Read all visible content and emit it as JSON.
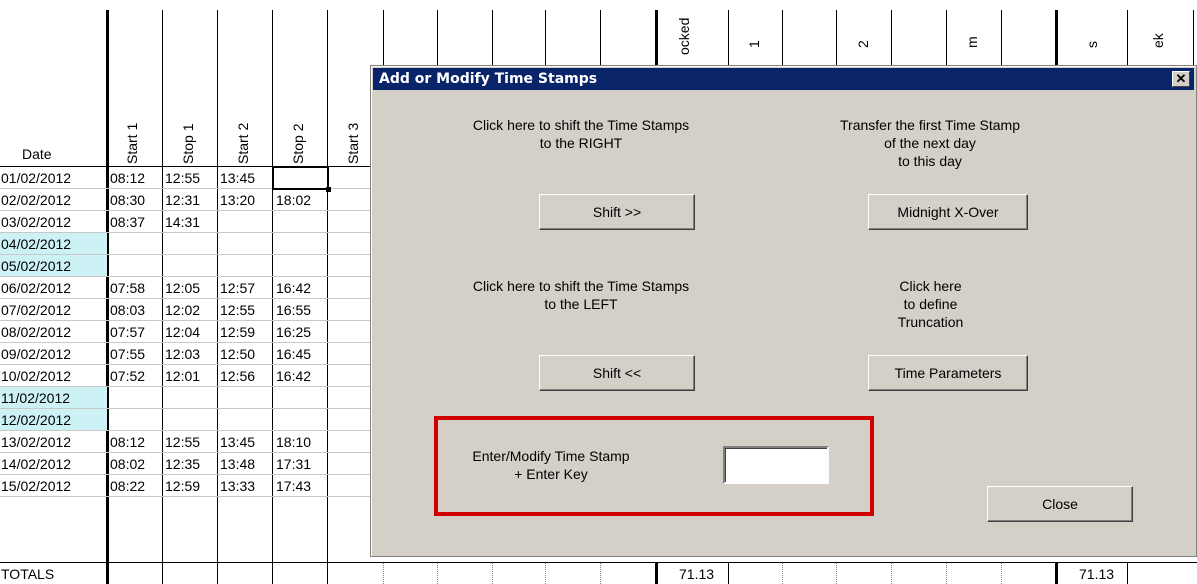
{
  "columns": {
    "date": "Date",
    "start1": "Start 1",
    "stop1": "Stop 1",
    "start2": "Start 2",
    "stop2": "Stop 2",
    "start3": "Start 3",
    "clocked_partial": "ocked",
    "col_1": "1",
    "col_2": "2",
    "col_m": "m",
    "col_s": "s",
    "col_ek": "ek"
  },
  "rows": [
    {
      "date": "01/02/2012",
      "start1": "08:12",
      "stop1": "12:55",
      "start2": "13:45",
      "stop2": "",
      "weekend": false
    },
    {
      "date": "02/02/2012",
      "start1": "08:30",
      "stop1": "12:31",
      "start2": "13:20",
      "stop2": "18:02",
      "weekend": false
    },
    {
      "date": "03/02/2012",
      "start1": "08:37",
      "stop1": "14:31",
      "start2": "",
      "stop2": "",
      "weekend": false
    },
    {
      "date": "04/02/2012",
      "start1": "",
      "stop1": "",
      "start2": "",
      "stop2": "",
      "weekend": true
    },
    {
      "date": "05/02/2012",
      "start1": "",
      "stop1": "",
      "start2": "",
      "stop2": "",
      "weekend": true
    },
    {
      "date": "06/02/2012",
      "start1": "07:58",
      "stop1": "12:05",
      "start2": "12:57",
      "stop2": "16:42",
      "weekend": false
    },
    {
      "date": "07/02/2012",
      "start1": "08:03",
      "stop1": "12:02",
      "start2": "12:55",
      "stop2": "16:55",
      "weekend": false
    },
    {
      "date": "08/02/2012",
      "start1": "07:57",
      "stop1": "12:04",
      "start2": "12:59",
      "stop2": "16:25",
      "weekend": false
    },
    {
      "date": "09/02/2012",
      "start1": "07:55",
      "stop1": "12:03",
      "start2": "12:50",
      "stop2": "16:45",
      "weekend": false
    },
    {
      "date": "10/02/2012",
      "start1": "07:52",
      "stop1": "12:01",
      "start2": "12:56",
      "stop2": "16:42",
      "weekend": false
    },
    {
      "date": "11/02/2012",
      "start1": "",
      "stop1": "",
      "start2": "",
      "stop2": "",
      "weekend": true
    },
    {
      "date": "12/02/2012",
      "start1": "",
      "stop1": "",
      "start2": "",
      "stop2": "",
      "weekend": true
    },
    {
      "date": "13/02/2012",
      "start1": "08:12",
      "stop1": "12:55",
      "start2": "13:45",
      "stop2": "18:10",
      "weekend": false
    },
    {
      "date": "14/02/2012",
      "start1": "08:02",
      "stop1": "12:35",
      "start2": "13:48",
      "stop2": "17:31",
      "weekend": false
    },
    {
      "date": "15/02/2012",
      "start1": "08:22",
      "stop1": "12:59",
      "start2": "13:33",
      "stop2": "17:43",
      "weekend": false
    }
  ],
  "totals": {
    "label": "TOTALS",
    "clocked": "71.13",
    "total_s": "71.13"
  },
  "dialog": {
    "title": "Add or Modify Time Stamps",
    "close_glyph": "✕",
    "shift_right_desc_1": "Click here to shift the Time Stamps",
    "shift_right_desc_2": "to the RIGHT",
    "shift_right_button": "Shift >>",
    "transfer_desc_1": "Transfer the first Time Stamp",
    "transfer_desc_2": "of the next day",
    "transfer_desc_3": "to this day",
    "midnight_button": "Midnight X-Over",
    "shift_left_desc_1": "Click here to shift the Time Stamps",
    "shift_left_desc_2": "to the LEFT",
    "shift_left_button": "Shift <<",
    "trunc_desc_1": "Click here",
    "trunc_desc_2": "to define",
    "trunc_desc_3": "Truncation",
    "time_params_button": "Time Parameters",
    "enter_label_1": "Enter/Modify Time Stamp",
    "enter_label_2": "+ Enter Key",
    "timestamp_value": "",
    "close_button": "Close"
  },
  "colors": {
    "weekend": "#ccf2f6",
    "dialog_bg": "#d4d0c8",
    "titlebar": "#0a246a",
    "highlight_box": "#d00000"
  }
}
